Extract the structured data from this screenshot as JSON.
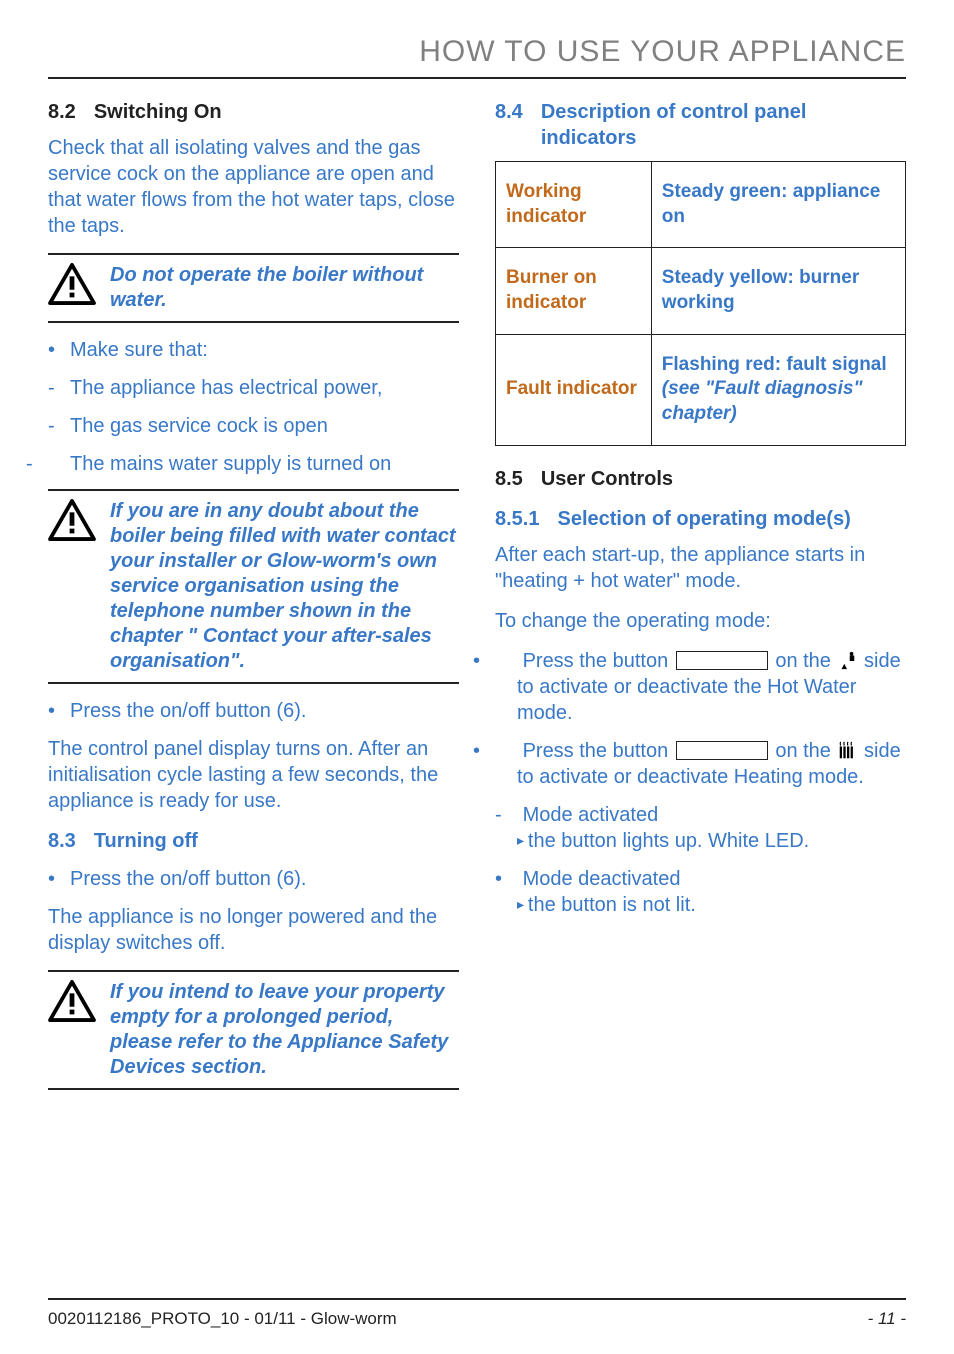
{
  "header": {
    "title": "HOW TO USE YOUR APPLIANCE"
  },
  "left": {
    "s82": {
      "num": "8.2",
      "title": "Switching On",
      "intro": "Check that all isolating valves and the gas service cock on the appliance are open and that water flows from the hot water taps, close the taps.",
      "caution": "Do not operate the boiler without water.",
      "bullet_intro": "Make sure that:",
      "items": [
        "The appliance has electrical power,",
        "The gas service cock is open",
        "The mains water supply is turned on"
      ],
      "caution2": "If you are in any doubt about the boiler being filled with water contact your installer or Glow-worm's own service organisation using the telephone number shown in the chapter \" Contact your after-sales organisation\".",
      "press": "Press the on/off button (6).",
      "after": "The control panel display turns on. After an initialisation cycle lasting a few seconds, the appliance is ready for use."
    },
    "s83": {
      "num": "8.3",
      "title": "Turning off",
      "press": "Press the on/off button (6).",
      "after": "The appliance is no longer powered and the display switches off.",
      "caution": "If you intend to leave your property empty for a prolonged period, please refer to the Appliance Safety Devices section."
    }
  },
  "right": {
    "s84": {
      "num": "8.4",
      "title": "Description of control panel indicators",
      "rows": [
        {
          "label": "Working indicator",
          "value": "Steady green: appliance on"
        },
        {
          "label": "Burner on indicator",
          "value": "Steady yellow: burner working"
        },
        {
          "label": "Fault indicator",
          "value": "Flashing red: fault signal ",
          "value_ital": "(see \"Fault diagnosis\" chapter)"
        }
      ]
    },
    "s85": {
      "num": "8.5",
      "title": "User Controls"
    },
    "s851": {
      "num": "8.5.1",
      "title": "Selection of operating mode(s)",
      "intro": "After each start-up, the appliance starts in \"heating + hot water\" mode.",
      "change": "To change the operating mode:",
      "press1a": "Press the button ",
      "press1b": " on the ",
      "press1c": " side to activate or deactivate the Hot Water mode.",
      "press2a": "Press the button ",
      "press2b": " on the ",
      "press2c": " side to activate or deactivate Heating mode.",
      "mode_act": "Mode activated",
      "mode_act_sub": "the button lights up. White LED.",
      "mode_deact": "Mode deactivated",
      "mode_deact_sub": "the button is not lit."
    }
  },
  "footer": {
    "left": "0020112186_PROTO_10 - 01/11 - Glow-worm",
    "right": "- 11 -"
  }
}
